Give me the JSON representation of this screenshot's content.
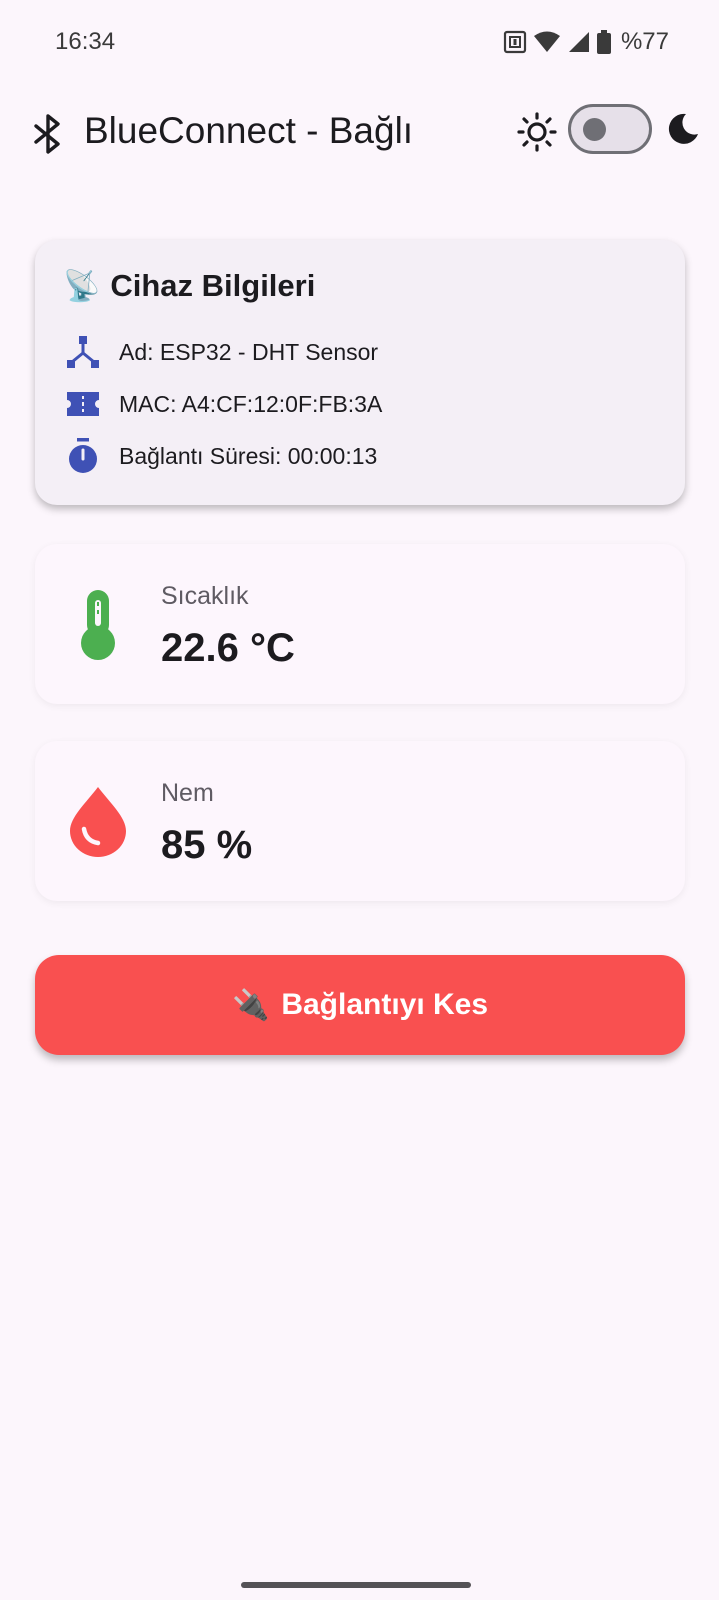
{
  "status_bar": {
    "time": "16:34",
    "battery": "%77",
    "icons": [
      "nfc-icon",
      "wifi-icon",
      "signal-icon",
      "battery-icon"
    ]
  },
  "app_bar": {
    "title": "BlueConnect - Bağlı",
    "bluetooth_icon": "bluetooth-icon",
    "theme_toggle": {
      "light_icon": "sun-icon",
      "dark_icon": "moon-icon",
      "dark_mode": false
    }
  },
  "device_card": {
    "emoji": "📡",
    "title": "Cihaz Bilgileri",
    "rows": [
      {
        "icon": "device-hub-icon",
        "text": "Ad: ESP32 - DHT Sensor"
      },
      {
        "icon": "ticket-icon",
        "text": "MAC: A4:CF:12:0F:FB:3A"
      },
      {
        "icon": "timer-icon",
        "text": "Bağlantı Süresi: 00:00:13"
      }
    ]
  },
  "sensors": [
    {
      "icon": "thermometer-icon",
      "label": "Sıcaklık",
      "value": "22.6 °C",
      "color": "#4caf50"
    },
    {
      "icon": "water-drop-icon",
      "label": "Nem",
      "value": "85 %",
      "color": "#f95050"
    }
  ],
  "disconnect": {
    "emoji": "🔌",
    "label": "Bağlantıyı Kes",
    "color": "#f95050"
  },
  "colors": {
    "accent": "#3f51b5",
    "background": "#fcf6fc"
  }
}
